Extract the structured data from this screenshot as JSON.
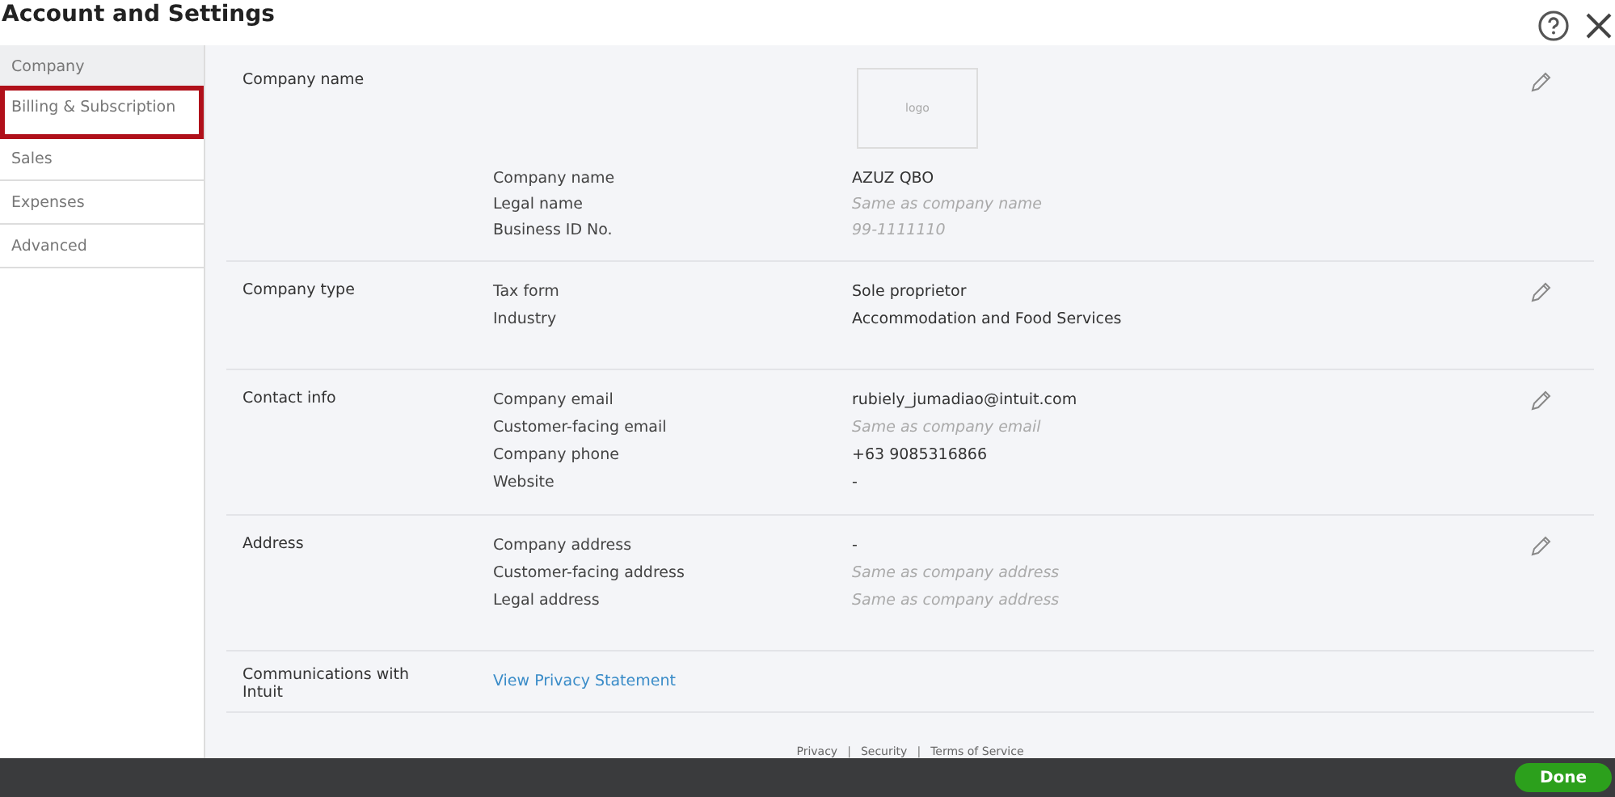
{
  "window": {
    "title": "Account and Settings"
  },
  "sidebar": {
    "items": [
      {
        "label": "Company",
        "selected": true,
        "annotated": false
      },
      {
        "label": "Billing & Subscription",
        "selected": false,
        "annotated": true
      },
      {
        "label": "Sales",
        "selected": false,
        "annotated": false
      },
      {
        "label": "Expenses",
        "selected": false,
        "annotated": false
      },
      {
        "label": "Advanced",
        "selected": false,
        "annotated": false
      }
    ]
  },
  "sections": [
    {
      "title": "Company name",
      "logo": "logo",
      "editable": true,
      "fields": [
        {
          "label": "Company name",
          "value": "AZUZ QBO",
          "muted": false
        },
        {
          "label": "Legal name",
          "value": "Same as company name",
          "muted": true
        },
        {
          "label": "Business ID No.",
          "value": "99-1111110",
          "muted": true
        }
      ]
    },
    {
      "title": "Company type",
      "editable": true,
      "fields": [
        {
          "label": "Tax form",
          "value": "Sole proprietor",
          "muted": false
        },
        {
          "label": "Industry",
          "value": "Accommodation and Food Services",
          "muted": false
        }
      ]
    },
    {
      "title": "Contact info",
      "editable": true,
      "fields": [
        {
          "label": "Company email",
          "value": "rubiely_jumadiao@intuit.com",
          "muted": false
        },
        {
          "label": "Customer-facing email",
          "value": "Same as company email",
          "muted": true
        },
        {
          "label": "Company phone",
          "value": "+63 9085316866",
          "muted": false
        },
        {
          "label": "Website",
          "value": "-",
          "muted": false
        }
      ]
    },
    {
      "title": "Address",
      "editable": true,
      "fields": [
        {
          "label": "Company address",
          "value": "-",
          "muted": false
        },
        {
          "label": "Customer-facing address",
          "value": "Same as company address",
          "muted": true
        },
        {
          "label": "Legal address",
          "value": "Same as company address",
          "muted": true
        }
      ]
    },
    {
      "title": "Communications with Intuit",
      "link": "View Privacy Statement"
    }
  ],
  "footer": [
    {
      "kind": "link",
      "text": "Privacy"
    },
    {
      "kind": "separator",
      "text": "|"
    },
    {
      "kind": "link",
      "text": "Security"
    },
    {
      "kind": "separator",
      "text": "|"
    },
    {
      "kind": "link",
      "text": "Terms of Service"
    }
  ],
  "done_button": "Done"
}
